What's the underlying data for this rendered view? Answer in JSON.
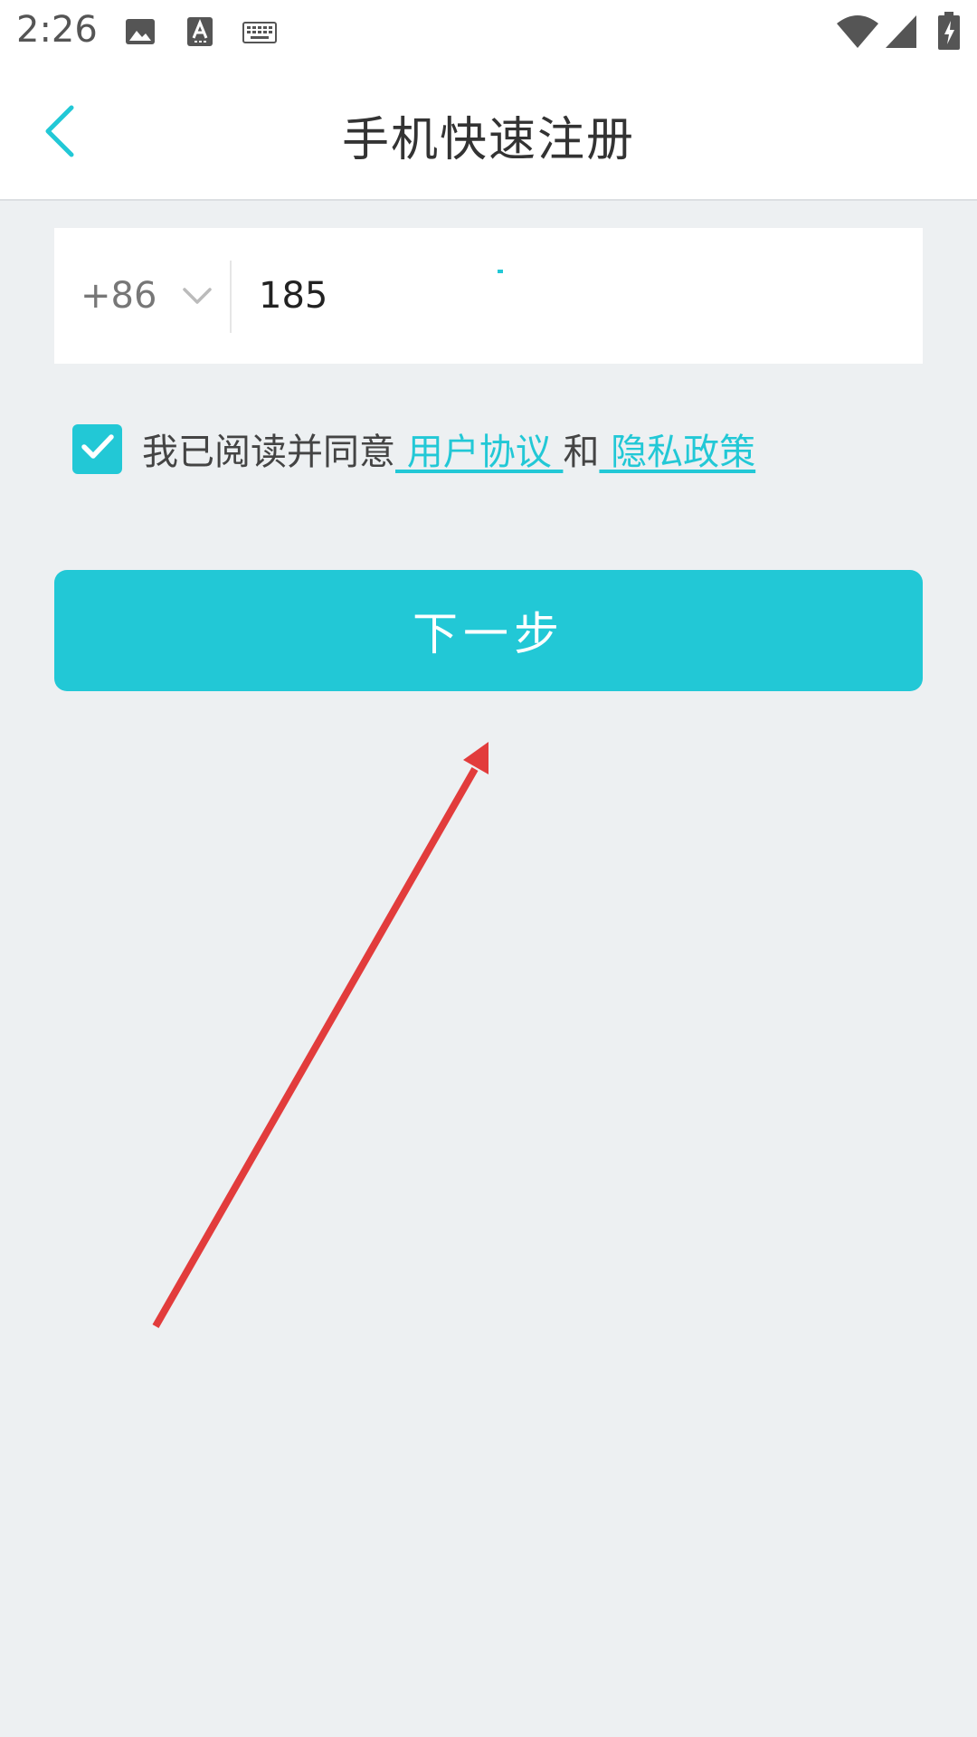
{
  "status_bar": {
    "time": "2:26",
    "icons": [
      "image-icon",
      "text-a-icon",
      "keyboard-icon",
      "wifi-icon",
      "cell-signal-icon",
      "battery-charging-icon"
    ]
  },
  "app_bar": {
    "title": "手机快速注册",
    "back_icon": "chevron-left-icon"
  },
  "phone_form": {
    "country_code": "+86",
    "phone_value": "185"
  },
  "agreement": {
    "checked": true,
    "prefix": "我已阅读并同意",
    "user_agreement": " 用户协议 ",
    "and": "和",
    "privacy_policy": " 隐私政策 "
  },
  "next_button": {
    "label": "下一步"
  },
  "colors": {
    "accent": "#22c8d6",
    "background": "#edf0f2",
    "annotation_arrow": "#e23c3c"
  }
}
